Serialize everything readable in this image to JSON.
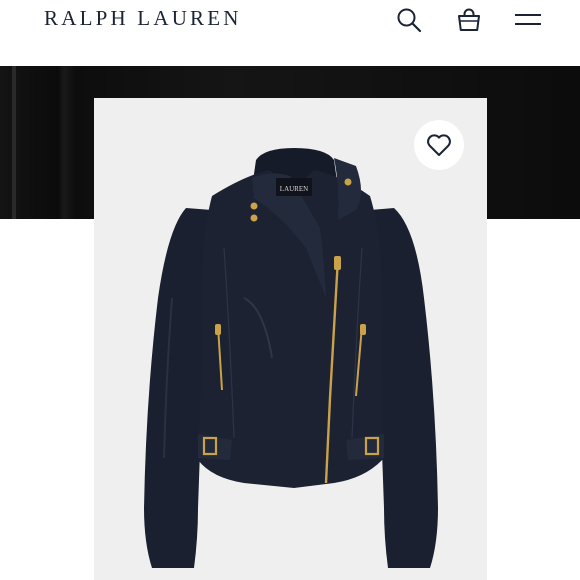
{
  "header": {
    "brand": "RALPH LAUREN",
    "icons": {
      "search": "search-icon",
      "bag": "shopping-bag-icon",
      "menu": "hamburger-menu-icon"
    }
  },
  "product": {
    "label_text": "LAUREN",
    "favorite_icon": "heart-outline-icon",
    "colors": {
      "jacket": "#1c2232",
      "hardware": "#c9a24a",
      "card_bg": "#efefef",
      "brand": "#1b2436"
    }
  }
}
